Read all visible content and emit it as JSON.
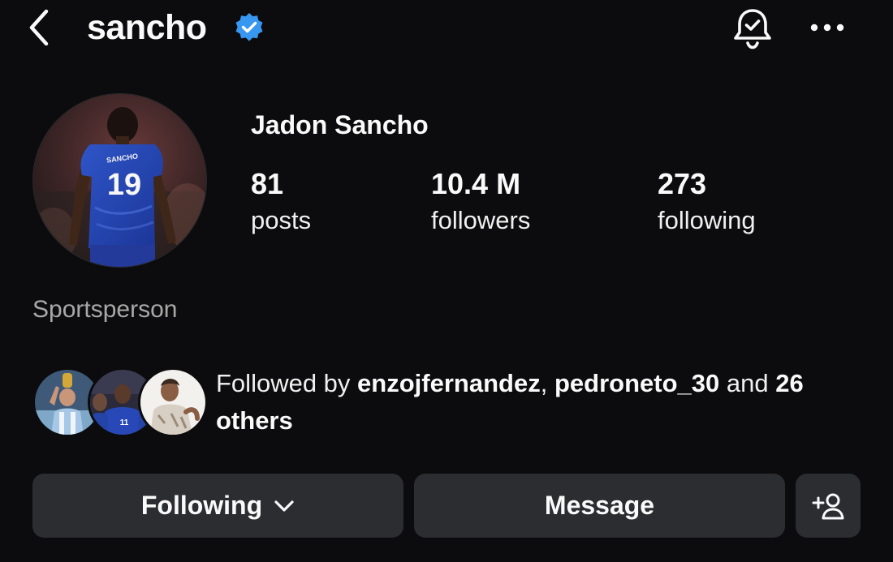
{
  "header": {
    "username": "sancho",
    "verified_icon": "verified-badge-icon",
    "back_icon": "chevron-left-icon",
    "notification_icon": "bell-check-icon",
    "more_icon": "more-horizontal-icon"
  },
  "profile": {
    "full_name": "Jadon Sancho",
    "category": "Sportsperson",
    "jersey": {
      "name": "SANCHO",
      "number": "19"
    }
  },
  "stats": {
    "posts": {
      "value": "81",
      "label": "posts"
    },
    "followers": {
      "value": "10.4 M",
      "label": "followers"
    },
    "following": {
      "value": "273",
      "label": "following"
    }
  },
  "mutuals": {
    "prefix": "Followed by",
    "names": [
      "enzojfernandez",
      "pedroneto_30"
    ],
    "separator": ",",
    "conjunction": "and",
    "others": "26 others"
  },
  "actions": {
    "following_label": "Following",
    "message_label": "Message",
    "suggest_icon": "add-person-icon"
  },
  "colors": {
    "background": "#0c0c0e",
    "button": "#2b2d31",
    "verified": "#3897f0",
    "secondary_text": "#a8a8a8"
  }
}
